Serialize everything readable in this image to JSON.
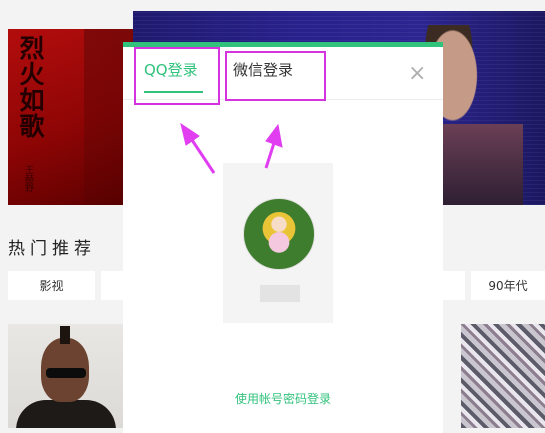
{
  "background": {
    "album_red_text": "烈火如歌",
    "album_red_subtext": "王赫野",
    "section_title": "热门推荐",
    "categories": [
      "影视",
      "90年代"
    ]
  },
  "modal": {
    "tabs": [
      {
        "label": "QQ登录",
        "active": true
      },
      {
        "label": "微信登录",
        "active": false
      }
    ],
    "close_icon": "close-icon",
    "account_login_link": "使用帐号密码登录"
  },
  "annotations": {
    "highlight_color": "#d633e0",
    "accent_color": "#31c27c"
  }
}
